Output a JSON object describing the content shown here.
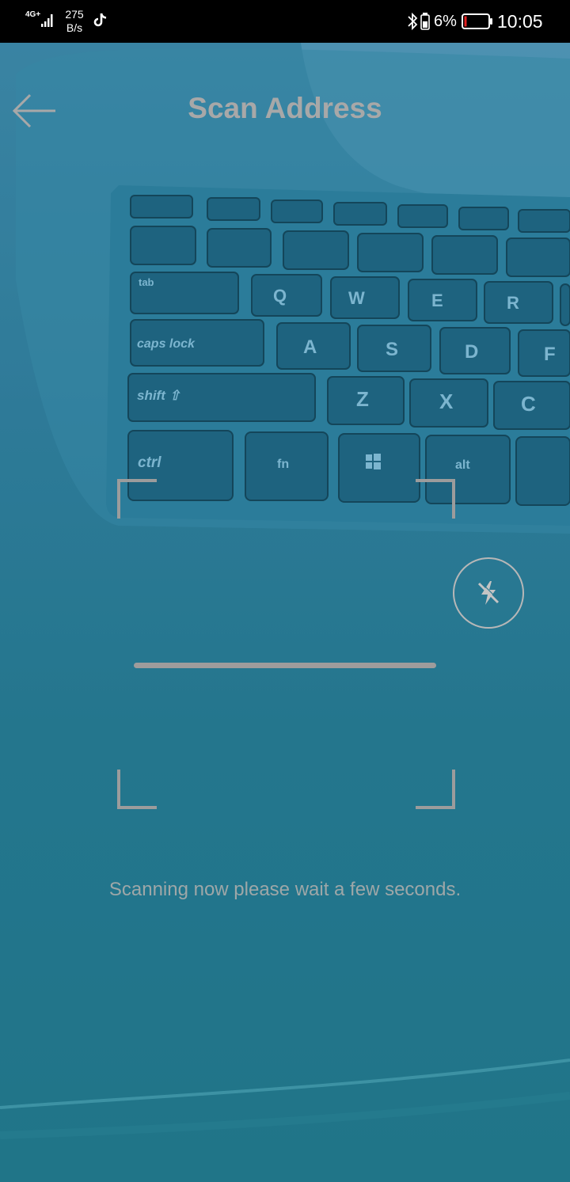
{
  "status_bar": {
    "network": "4G+",
    "speed_value": "275",
    "speed_unit": "B/s",
    "battery_percent": "6%",
    "time": "10:05",
    "icons": [
      "signal-icon",
      "tiktok-icon",
      "bluetooth-icon",
      "battery-icon"
    ]
  },
  "header": {
    "back_icon": "arrow-left-icon",
    "title": "Scan Address"
  },
  "scanner": {
    "flash_icon": "flash-off-icon",
    "hint": "Scanning now please wait a few seconds."
  },
  "keyboard_keys": [
    "tab",
    "Q",
    "W",
    "E",
    "R",
    "caps lock",
    "A",
    "S",
    "D",
    "F",
    "shift",
    "Z",
    "X",
    "C",
    "ctrl",
    "fn",
    "alt"
  ],
  "colors": {
    "title": "#a8a8a8",
    "frame": "#9c9c9c",
    "hint": "#9ea7a8",
    "background": "#2a7a94"
  }
}
